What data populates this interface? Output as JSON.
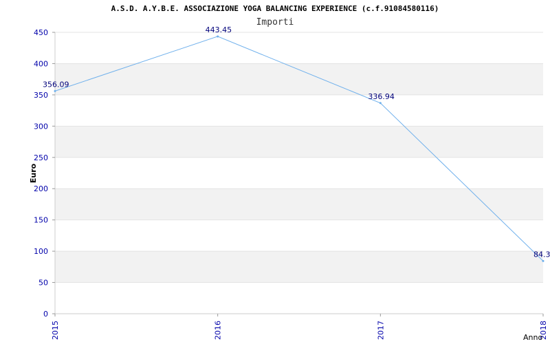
{
  "chart_data": {
    "type": "line",
    "title": "A.S.D. A.Y.B.E. ASSOCIAZIONE YOGA BALANCING EXPERIENCE (c.f.91084580116)",
    "subtitle": "Importi",
    "xlabel": "Anno",
    "ylabel": "Euro",
    "x": [
      "2015",
      "2016",
      "2017",
      "2018"
    ],
    "series": [
      {
        "values": [
          356.09,
          443.45,
          336.94,
          84.3
        ],
        "labels": [
          "356.09",
          "443.45",
          "336.94",
          "84.30"
        ],
        "color": "#6fb0ec"
      }
    ],
    "ylim": [
      0,
      450
    ],
    "yticks": [
      0,
      50,
      100,
      150,
      200,
      250,
      300,
      350,
      400,
      450
    ],
    "grid": true,
    "band_color": "#f2f2f2",
    "axis_label_color": "#0000aa",
    "data_label_color": "#00007a"
  }
}
